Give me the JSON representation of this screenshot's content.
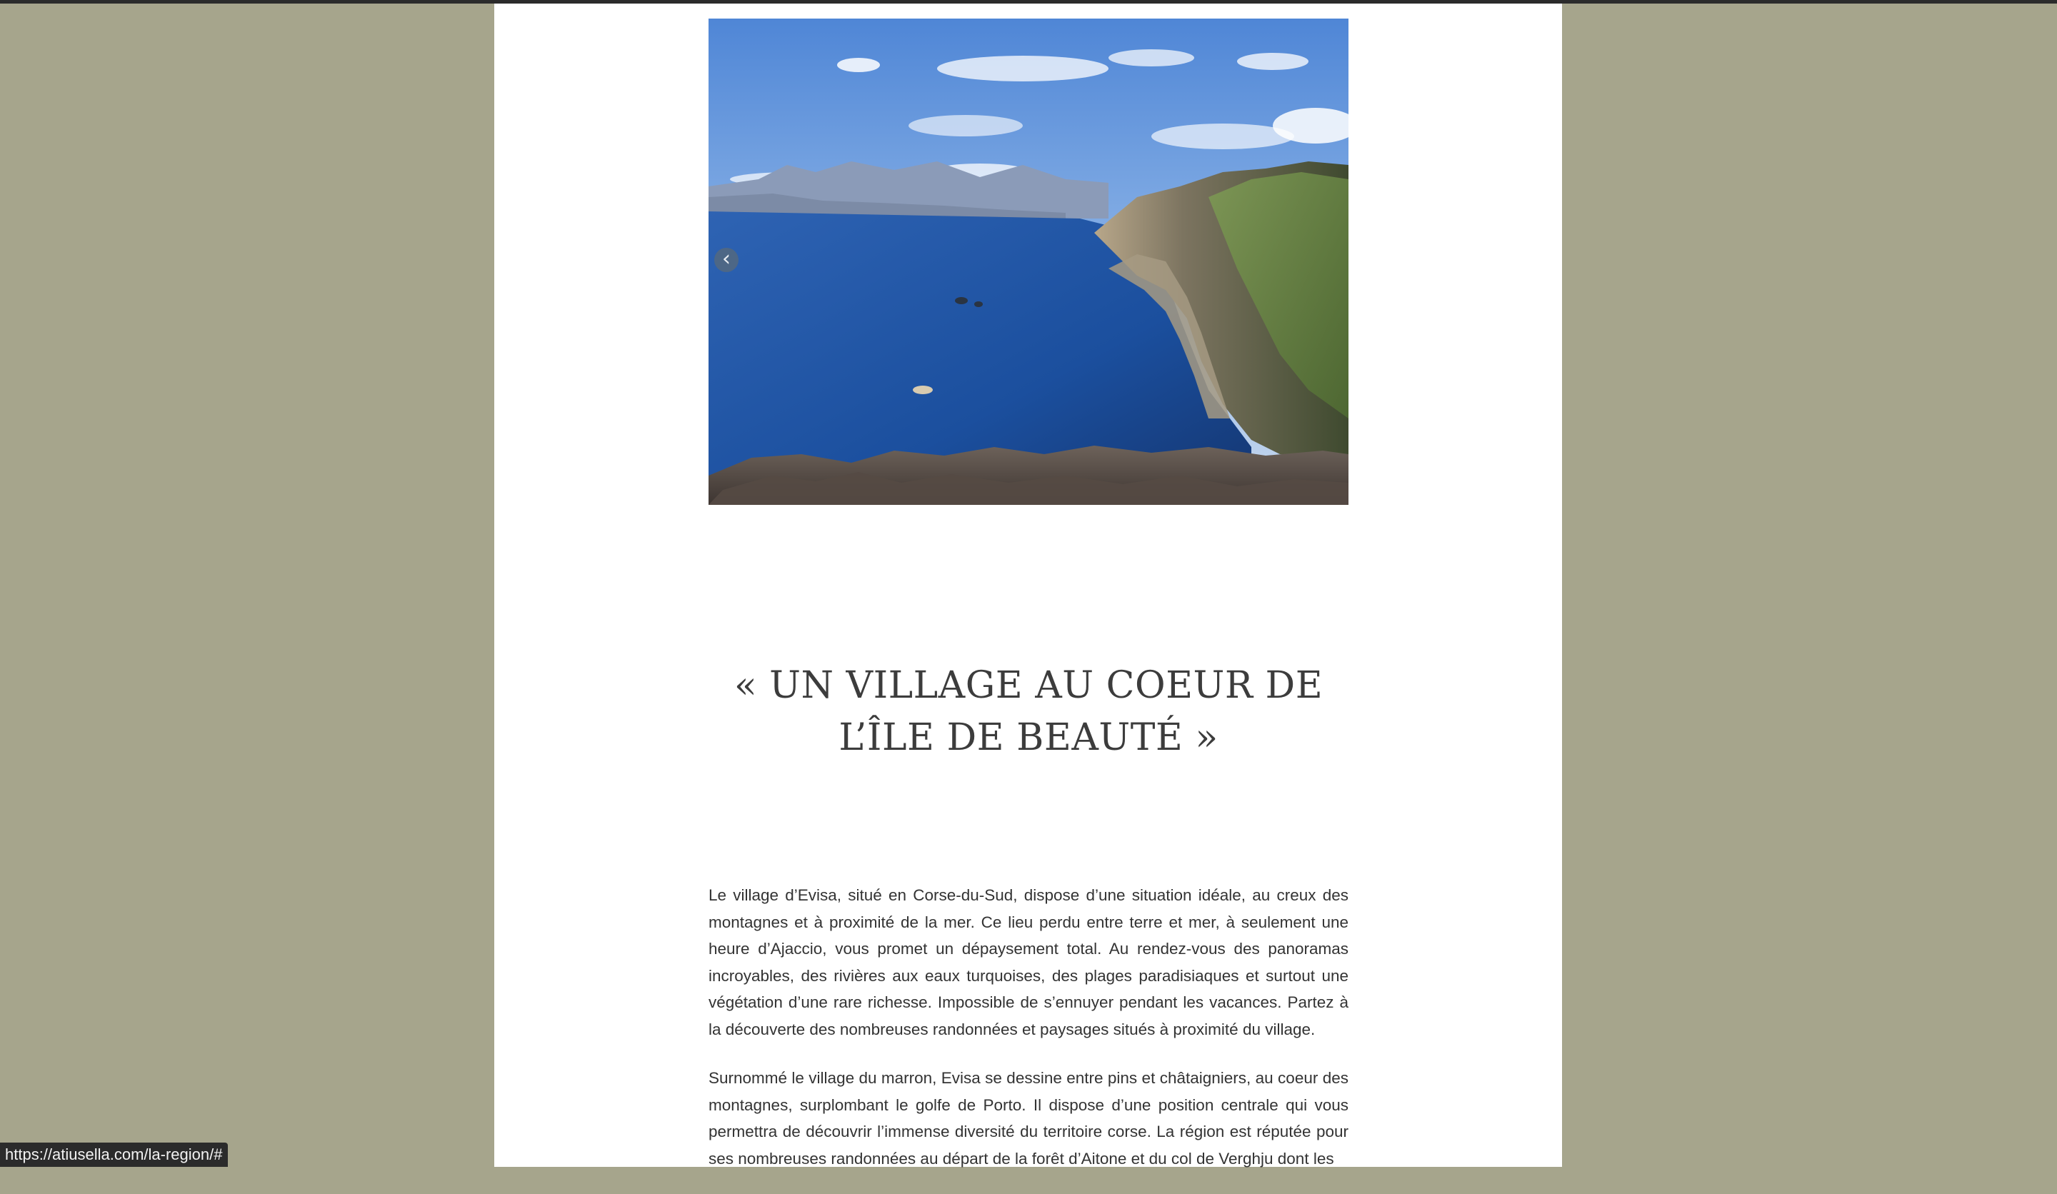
{
  "slider": {
    "image_alt": "Vue panoramique des falaises de la côte corse au-dessus de la mer",
    "prev_icon": "‹"
  },
  "headline": {
    "line1": "« UN VILLAGE AU COEUR DE",
    "line2": "L’ÎLE DE BEAUTÉ  »"
  },
  "article": {
    "paragraph1": "Le village d’Evisa, situé en Corse-du-Sud, dispose d’une situation idéale, au creux des montagnes et à proximité de la mer. Ce lieu perdu entre terre et mer, à seulement une heure d’Ajaccio, vous promet un dépaysement total. Au rendez-vous des panoramas incroyables, des rivières aux eaux turquoises, des plages paradisiaques et surtout une végétation d’une rare richesse. Impossible de s’ennuyer pendant les vacances. Partez à la découverte des nombreuses randonnées  et paysages situés à proximité du village.",
    "paragraph2": "Surnommé le village du marron, Evisa se dessine entre pins et châtaigniers, au coeur des montagnes, surplombant le golfe de Porto. Il dispose d’une position centrale qui vous permettra de découvrir l’immense diversité du territoire corse. La région est réputée pour ses nombreuses randonnées au départ de la forêt d’Aitone et du col de Verghju dont les"
  },
  "status_bar": {
    "url": "https://atiusella.com/la-region/#"
  },
  "colors": {
    "background": "#a6a58c",
    "page": "#ffffff",
    "text": "#333333",
    "headline": "#3c3c3c"
  }
}
